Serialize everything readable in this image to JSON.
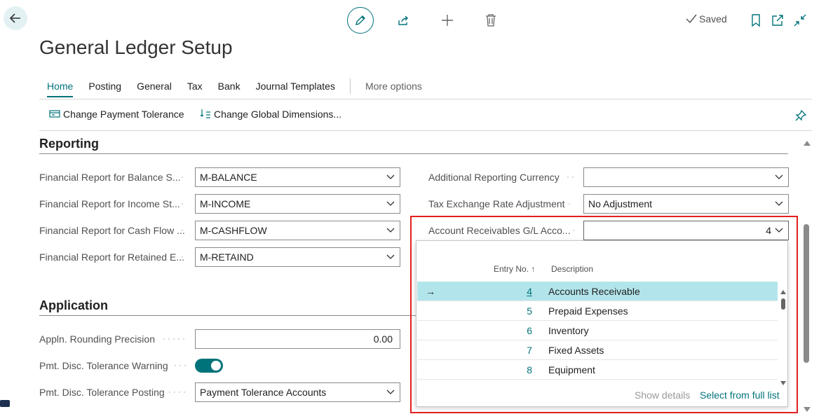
{
  "header": {
    "title": "General Ledger Setup",
    "status": "Saved"
  },
  "tabs": [
    {
      "label": "Home"
    },
    {
      "label": "Posting"
    },
    {
      "label": "General"
    },
    {
      "label": "Tax"
    },
    {
      "label": "Bank"
    },
    {
      "label": "Journal Templates"
    }
  ],
  "more_options": "More options",
  "actions": {
    "change_payment_tolerance": "Change Payment Tolerance",
    "change_global_dimensions": "Change Global Dimensions..."
  },
  "reporting": {
    "title": "Reporting",
    "left_fields": [
      {
        "label": "Financial Report for Balance S...",
        "value": "M-BALANCE"
      },
      {
        "label": "Financial Report for Income St...",
        "value": "M-INCOME"
      },
      {
        "label": "Financial Report for Cash Flow ...",
        "value": "M-CASHFLOW"
      },
      {
        "label": "Financial Report for Retained E...",
        "value": "M-RETAIND"
      }
    ],
    "additional_currency": {
      "label": "Additional Reporting Currency",
      "value": ""
    },
    "tax_exchange": {
      "label": "Tax Exchange Rate Adjustment",
      "value": "No Adjustment"
    },
    "ar_account": {
      "label": "Account Receivables G/L Acco...",
      "value": "4"
    }
  },
  "application": {
    "title": "Application",
    "rounding": {
      "label": "Appln. Rounding Precision",
      "value": "0.00"
    },
    "tolerance_warning": {
      "label": "Pmt. Disc. Tolerance Warning",
      "on": true
    },
    "tolerance_posting": {
      "label": "Pmt. Disc. Tolerance Posting",
      "value": "Payment Tolerance Accounts"
    }
  },
  "lookup": {
    "col_entry": "Entry No.",
    "col_desc": "Description",
    "rows": [
      {
        "no": "4",
        "desc": "Accounts Receivable"
      },
      {
        "no": "5",
        "desc": "Prepaid Expenses"
      },
      {
        "no": "6",
        "desc": "Inventory"
      },
      {
        "no": "7",
        "desc": "Fixed Assets"
      },
      {
        "no": "8",
        "desc": "Equipment"
      }
    ],
    "show_details": "Show details",
    "select_full_list": "Select from full list"
  },
  "colors": {
    "accent": "#00737a",
    "selection": "#b2e5eb",
    "highlight_box": "#e02020"
  }
}
